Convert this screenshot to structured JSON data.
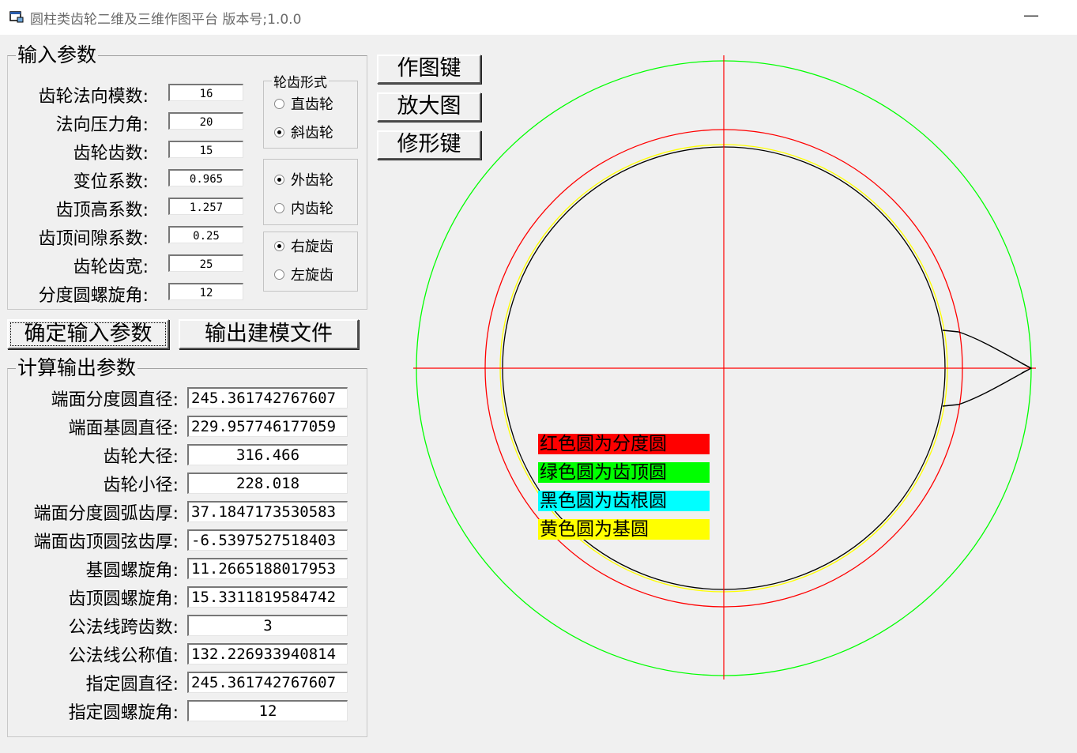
{
  "window": {
    "title": "圆柱类齿轮二维及三维作图平台 版本号;1.0.0",
    "minimize": "—"
  },
  "input_group": {
    "legend": "输入参数",
    "fields": [
      {
        "label": "齿轮法向模数:",
        "value": "16"
      },
      {
        "label": "法向压力角:",
        "value": "20"
      },
      {
        "label": "齿轮齿数:",
        "value": "15"
      },
      {
        "label": "变位系数:",
        "value": "0.965"
      },
      {
        "label": "齿顶高系数:",
        "value": "1.257"
      },
      {
        "label": "齿顶间隙系数:",
        "value": "0.25"
      },
      {
        "label": "齿轮齿宽:",
        "value": "25"
      },
      {
        "label": "分度圆螺旋角:",
        "value": "12"
      }
    ]
  },
  "tooth_form": {
    "legend": "轮齿形式",
    "options": [
      "直齿轮",
      "斜齿轮"
    ],
    "selected": "斜齿轮"
  },
  "gear_type": {
    "options": [
      "外齿轮",
      "内齿轮"
    ],
    "selected": "外齿轮"
  },
  "helix_dir": {
    "options": [
      "右旋齿",
      "左旋齿"
    ],
    "selected": "右旋齿"
  },
  "buttons": {
    "confirm": "确定输入参数",
    "export": "输出建模文件",
    "draw": "作图键",
    "zoom": "放大图",
    "modify": "修形键"
  },
  "output_group": {
    "legend": "计算输出参数",
    "fields": [
      {
        "label": "端面分度圆直径:",
        "value": "245.361742767607"
      },
      {
        "label": "端面基圆直径:",
        "value": "229.957746177059"
      },
      {
        "label": "齿轮大径:",
        "value": "316.466"
      },
      {
        "label": "齿轮小径:",
        "value": "228.018"
      },
      {
        "label": "端面分度圆弧齿厚:",
        "value": "37.1847173530583"
      },
      {
        "label": "端面齿顶圆弦齿厚:",
        "value": "-6.5397527518403"
      },
      {
        "label": "基圆螺旋角:",
        "value": "11.2665188017953"
      },
      {
        "label": "齿顶圆螺旋角:",
        "value": "15.3311819584742"
      },
      {
        "label": "公法线跨齿数:",
        "value": "3"
      },
      {
        "label": "公法线公称值:",
        "value": "132.226933940814"
      },
      {
        "label": "指定圆直径:",
        "value": "245.361742767607"
      },
      {
        "label": "指定圆螺旋角:",
        "value": "12"
      }
    ]
  },
  "circle_legend": [
    {
      "text": "红色圆为分度圆",
      "bg": "#ff0000"
    },
    {
      "text": "绿色圆为齿顶圆",
      "bg": "#00ff00"
    },
    {
      "text": "黑色圆为齿根圆",
      "bg": "#00ffff"
    },
    {
      "text": "黄色圆为基圆",
      "bg": "#ffff00"
    }
  ],
  "colors": {
    "pitch_circle": "#ff0000",
    "tip_circle": "#00ff00",
    "root_circle": "#000000",
    "base_circle": "#ffff00",
    "axes": "#ff0000",
    "tooth_profile": "#000000"
  },
  "drawing": {
    "tip_diameter": 316.466,
    "pitch_diameter": 245.361742767607,
    "base_diameter": 229.957746177059,
    "root_diameter": 228.018
  }
}
